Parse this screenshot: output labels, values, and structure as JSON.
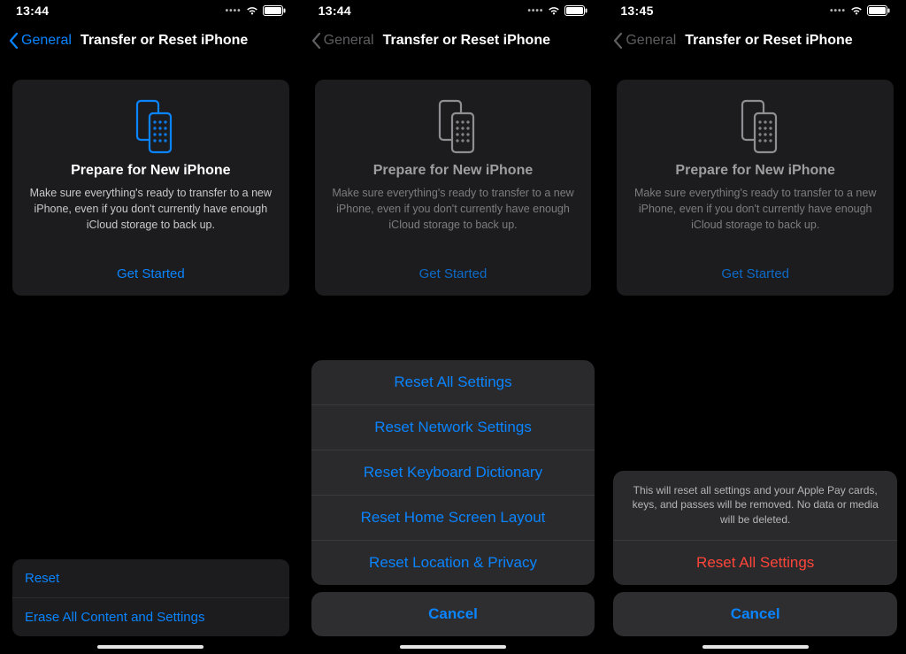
{
  "colors": {
    "accent": "#0a84ff",
    "destructive": "#ff453a",
    "card": "#1c1c1e",
    "sheet": "#2a2a2c"
  },
  "panel1": {
    "status_time": "13:44",
    "back_label": "General",
    "nav_title": "Transfer or Reset iPhone",
    "hero_title": "Prepare for New iPhone",
    "hero_body": "Make sure everything's ready to transfer to a new iPhone, even if you don't currently have enough iCloud storage to back up.",
    "hero_cta": "Get Started",
    "rows": [
      "Reset",
      "Erase All Content and Settings"
    ]
  },
  "panel2": {
    "status_time": "13:44",
    "back_label": "General",
    "nav_title": "Transfer or Reset iPhone",
    "hero_title": "Prepare for New iPhone",
    "hero_body": "Make sure everything's ready to transfer to a new iPhone, even if you don't currently have enough iCloud storage to back up.",
    "hero_cta": "Get Started",
    "sheet_options": [
      "Reset All Settings",
      "Reset Network Settings",
      "Reset Keyboard Dictionary",
      "Reset Home Screen Layout",
      "Reset Location & Privacy"
    ],
    "cancel": "Cancel"
  },
  "panel3": {
    "status_time": "13:45",
    "back_label": "General",
    "nav_title": "Transfer or Reset iPhone",
    "hero_title": "Prepare for New iPhone",
    "hero_body": "Make sure everything's ready to transfer to a new iPhone, even if you don't currently have enough iCloud storage to back up.",
    "hero_cta": "Get Started",
    "confirm_message": "This will reset all settings and your Apple Pay cards, keys, and passes will be removed. No data or media will be deleted.",
    "confirm_action": "Reset All Settings",
    "cancel": "Cancel"
  }
}
